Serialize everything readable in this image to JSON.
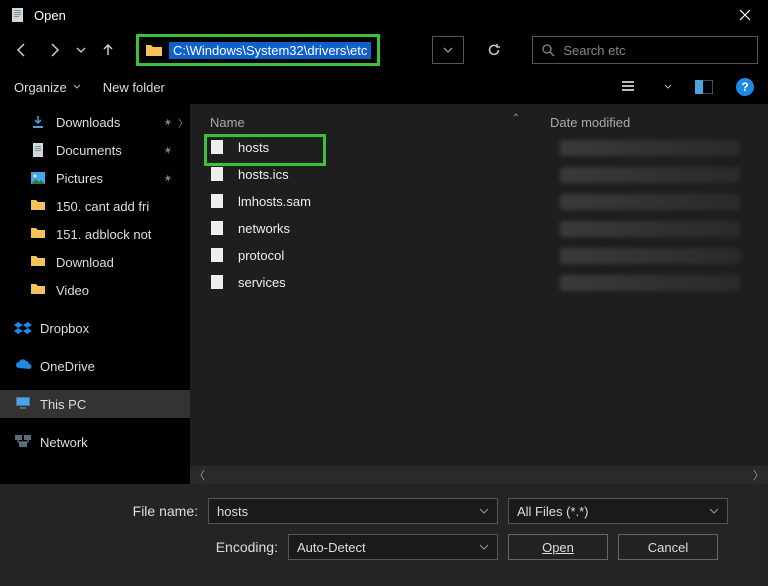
{
  "window": {
    "title": "Open"
  },
  "nav": {
    "path": "C:\\Windows\\System32\\drivers\\etc",
    "search_placeholder": "Search etc"
  },
  "toolbar": {
    "organize": "Organize",
    "new_folder": "New folder"
  },
  "sidebar": {
    "quick": [
      {
        "label": "Downloads",
        "icon": "download"
      },
      {
        "label": "Documents",
        "icon": "document"
      },
      {
        "label": "Pictures",
        "icon": "picture"
      },
      {
        "label": "150. cant add fri",
        "icon": "folder"
      },
      {
        "label": "151. adblock not",
        "icon": "folder"
      },
      {
        "label": "Download",
        "icon": "folder"
      },
      {
        "label": "Video",
        "icon": "folder"
      }
    ],
    "groups": [
      {
        "label": "Dropbox",
        "icon": "dropbox"
      },
      {
        "label": "OneDrive",
        "icon": "onedrive"
      },
      {
        "label": "This PC",
        "icon": "thispc",
        "selected": true
      },
      {
        "label": "Network",
        "icon": "network"
      }
    ]
  },
  "columns": {
    "name": "Name",
    "date": "Date modified"
  },
  "files": [
    {
      "name": "hosts",
      "highlight": true
    },
    {
      "name": "hosts.ics"
    },
    {
      "name": "lmhosts.sam"
    },
    {
      "name": "networks"
    },
    {
      "name": "protocol"
    },
    {
      "name": "services"
    }
  ],
  "bottom": {
    "file_label": "File name:",
    "file_value": "hosts",
    "filter": "All Files  (*.*)",
    "encoding_label": "Encoding:",
    "encoding_value": "Auto-Detect",
    "open": "Open",
    "cancel": "Cancel"
  }
}
